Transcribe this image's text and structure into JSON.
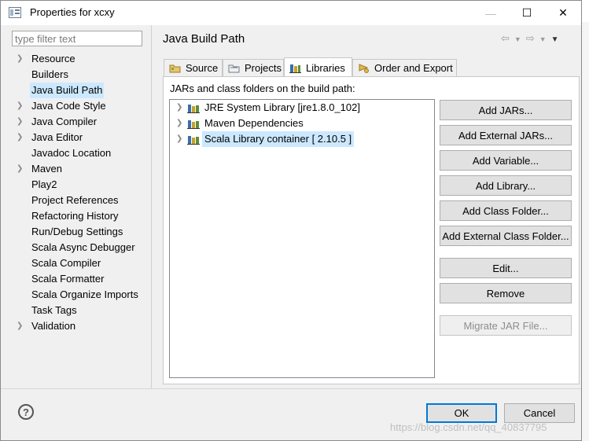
{
  "window": {
    "title": "Properties for xcxy",
    "minimize_glyph": "—",
    "maximize_glyph": "☐",
    "close_glyph": "✕"
  },
  "filter": {
    "placeholder": "type filter text",
    "value": ""
  },
  "left_tree": [
    {
      "label": "Resource",
      "expandable": true
    },
    {
      "label": "Builders",
      "expandable": false
    },
    {
      "label": "Java Build Path",
      "expandable": false,
      "selected": true
    },
    {
      "label": "Java Code Style",
      "expandable": true
    },
    {
      "label": "Java Compiler",
      "expandable": true
    },
    {
      "label": "Java Editor",
      "expandable": true
    },
    {
      "label": "Javadoc Location",
      "expandable": false
    },
    {
      "label": "Maven",
      "expandable": true
    },
    {
      "label": "Play2",
      "expandable": false
    },
    {
      "label": "Project References",
      "expandable": false
    },
    {
      "label": "Refactoring History",
      "expandable": false
    },
    {
      "label": "Run/Debug Settings",
      "expandable": false
    },
    {
      "label": "Scala Async Debugger",
      "expandable": false
    },
    {
      "label": "Scala Compiler",
      "expandable": false
    },
    {
      "label": "Scala Formatter",
      "expandable": false
    },
    {
      "label": "Scala Organize Imports",
      "expandable": false
    },
    {
      "label": "Task Tags",
      "expandable": false
    },
    {
      "label": "Validation",
      "expandable": true
    }
  ],
  "page": {
    "title": "Java Build Path"
  },
  "tabs": [
    {
      "label": "Source",
      "icon": "source-folder-icon"
    },
    {
      "label": "Projects",
      "icon": "projects-icon"
    },
    {
      "label": "Libraries",
      "icon": "libraries-icon",
      "active": true
    },
    {
      "label": "Order and Export",
      "icon": "order-export-icon"
    }
  ],
  "libraries": {
    "caption": "JARs and class folders on the build path:",
    "items": [
      {
        "label": "JRE System Library [jre1.8.0_102]"
      },
      {
        "label": "Maven Dependencies"
      },
      {
        "label": "Scala Library container [ 2.10.5 ]",
        "selected": true
      }
    ]
  },
  "buttons": {
    "add_jars": "Add JARs...",
    "add_external_jars": "Add External JARs...",
    "add_variable": "Add Variable...",
    "add_library": "Add Library...",
    "add_class_folder": "Add Class Folder...",
    "add_external_class_folder": "Add External Class Folder...",
    "edit": "Edit...",
    "remove": "Remove",
    "migrate_jar": "Migrate JAR File..."
  },
  "footer": {
    "help": "?",
    "ok": "OK",
    "cancel": "Cancel"
  },
  "watermark": "https://blog.csdn.net/qq_40837795",
  "colors": {
    "selection": "#cce8ff",
    "accent": "#0078d7"
  }
}
